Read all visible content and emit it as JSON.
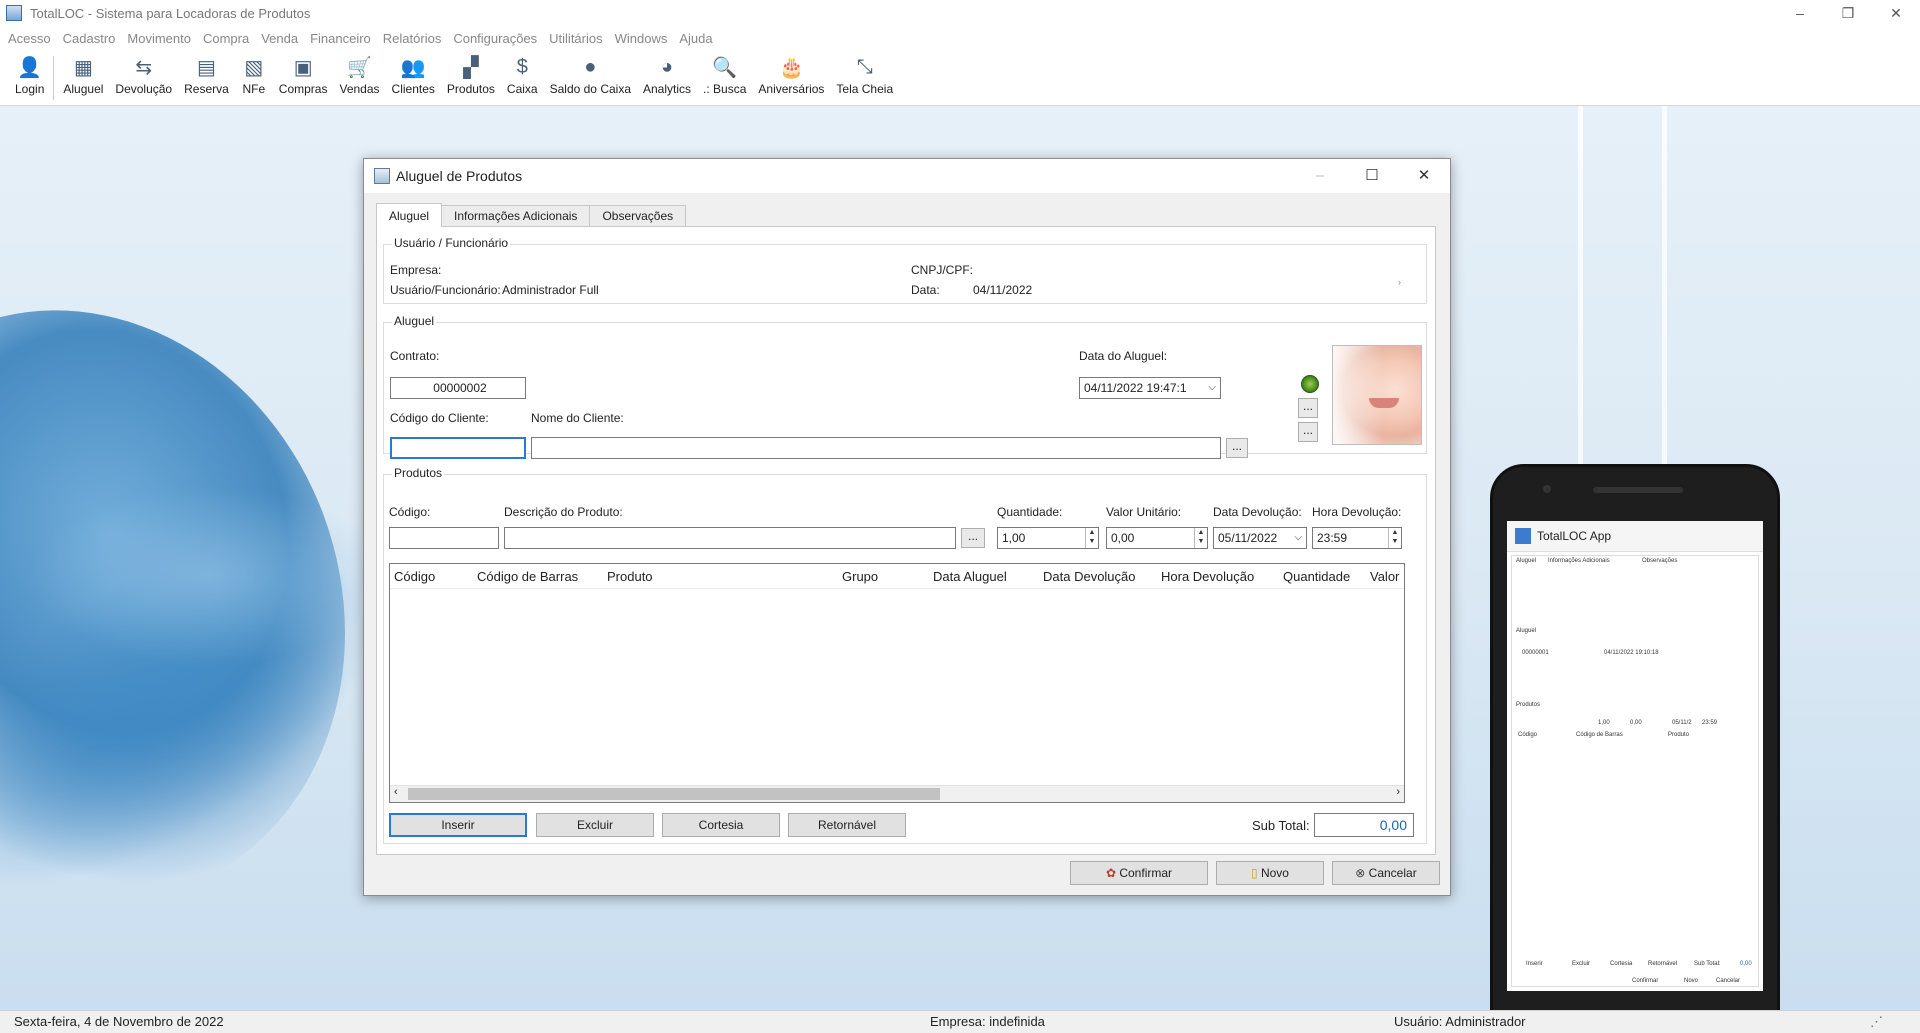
{
  "app": {
    "title": "TotalLOC - Sistema para Locadoras de Produtos",
    "win_min": "–",
    "win_restore": "❐",
    "win_close": "✕"
  },
  "menu": [
    "Acesso",
    "Cadastro",
    "Movimento",
    "Compra",
    "Venda",
    "Financeiro",
    "Relatórios",
    "Configurações",
    "Utilitários",
    "Windows",
    "Ajuda"
  ],
  "toolbar": [
    {
      "label": "Login",
      "icon": "user-icon",
      "glyph": "👤"
    },
    {
      "label": "Aluguel",
      "icon": "calculator-icon",
      "glyph": "▦"
    },
    {
      "label": "Devolução",
      "icon": "return-icon",
      "glyph": "⇆"
    },
    {
      "label": "Reserva",
      "icon": "calendar-icon",
      "glyph": "▤"
    },
    {
      "label": "NFe",
      "icon": "invoice-icon",
      "glyph": "▧"
    },
    {
      "label": "Compras",
      "icon": "bag-icon",
      "glyph": "▣"
    },
    {
      "label": "Vendas",
      "icon": "cart-icon",
      "glyph": "🛒"
    },
    {
      "label": "Clientes",
      "icon": "users-icon",
      "glyph": "👥"
    },
    {
      "label": "Produtos",
      "icon": "grid-icon",
      "glyph": "▞"
    },
    {
      "label": "Caixa",
      "icon": "cash-icon",
      "glyph": "$"
    },
    {
      "label": "Saldo do Caixa",
      "icon": "piggy-bank-icon",
      "glyph": "●"
    },
    {
      "label": "Analytics",
      "icon": "pie-chart-icon",
      "glyph": "◕"
    },
    {
      "label": ".: Busca",
      "icon": "search-icon",
      "glyph": "🔍"
    },
    {
      "label": "Aniversários",
      "icon": "cake-icon",
      "glyph": "🎂"
    },
    {
      "label": "Tela Cheia",
      "icon": "fullscreen-icon",
      "glyph": "⤡"
    }
  ],
  "dialog": {
    "title": "Aluguel de Produtos",
    "tabs": [
      "Aluguel",
      "Informações Adicionais",
      "Observações"
    ],
    "usuario_group": "Usuário / Funcionário",
    "empresa_label": "Empresa:",
    "usuario_label": "Usuário/Funcionário:",
    "usuario_value": "Administrador Full",
    "cnpj_label": "CNPJ/CPF:",
    "data_label": "Data:",
    "data_value": "04/11/2022",
    "aluguel_group": "Aluguel",
    "contrato_label": "Contrato:",
    "contrato_value": "00000002",
    "data_aluguel_label": "Data do Aluguel:",
    "data_aluguel_value": "04/11/2022 19:47:1",
    "codigo_cliente_label": "Código do Cliente:",
    "codigo_cliente_value": "",
    "nome_cliente_label": "Nome do Cliente:",
    "nome_cliente_value": "",
    "dots": "...",
    "produtos_group": "Produtos",
    "codigo_label": "Código:",
    "descricao_label": "Descrição do Produto:",
    "quantidade_label": "Quantidade:",
    "quantidade_value": "1,00",
    "valor_unit_label": "Valor Unitário:",
    "valor_unit_value": "0,00",
    "data_dev_label": "Data Devolução:",
    "data_dev_value": "05/11/2022",
    "hora_dev_label": "Hora Devolução:",
    "hora_dev_value": "23:59",
    "columns": [
      "Código",
      "Código de Barras",
      "Produto",
      "Grupo",
      "Data Aluguel",
      "Data Devolução",
      "Hora Devolução",
      "Quantidade",
      "Valor"
    ],
    "btn_inserir": "Inserir",
    "btn_excluir": "Excluir",
    "btn_cortesia": "Cortesia",
    "btn_retornavel": "Retornável",
    "subtotal_label": "Sub Total:",
    "subtotal_value": "0,00",
    "btn_confirmar": "Confirmar",
    "btn_novo": "Novo",
    "btn_cancelar": "Cancelar"
  },
  "phone": {
    "app_title": "TotalLOC App",
    "tabs": [
      "Aluguel",
      "Informações Adicionais",
      "Observações"
    ],
    "contrato": "00000001",
    "data_aluguel": "04/11/2022 19:10:18",
    "quantidade": "1,00",
    "valor": "0,00",
    "data_dev": "05/11/2",
    "hora_dev": "23:59",
    "btns": [
      "Inserir",
      "Excluir",
      "Cortesia",
      "Retornável"
    ],
    "subtotal_label": "Sub Total:",
    "subtotal": "0,00",
    "confirmar": "Confirmar",
    "novo": "Novo",
    "cancelar": "Cancelar"
  },
  "status": {
    "date": "Sexta-feira, 4 de Novembro de 2022",
    "empresa": "Empresa: indefinida",
    "usuario": "Usuário: Administrador"
  }
}
